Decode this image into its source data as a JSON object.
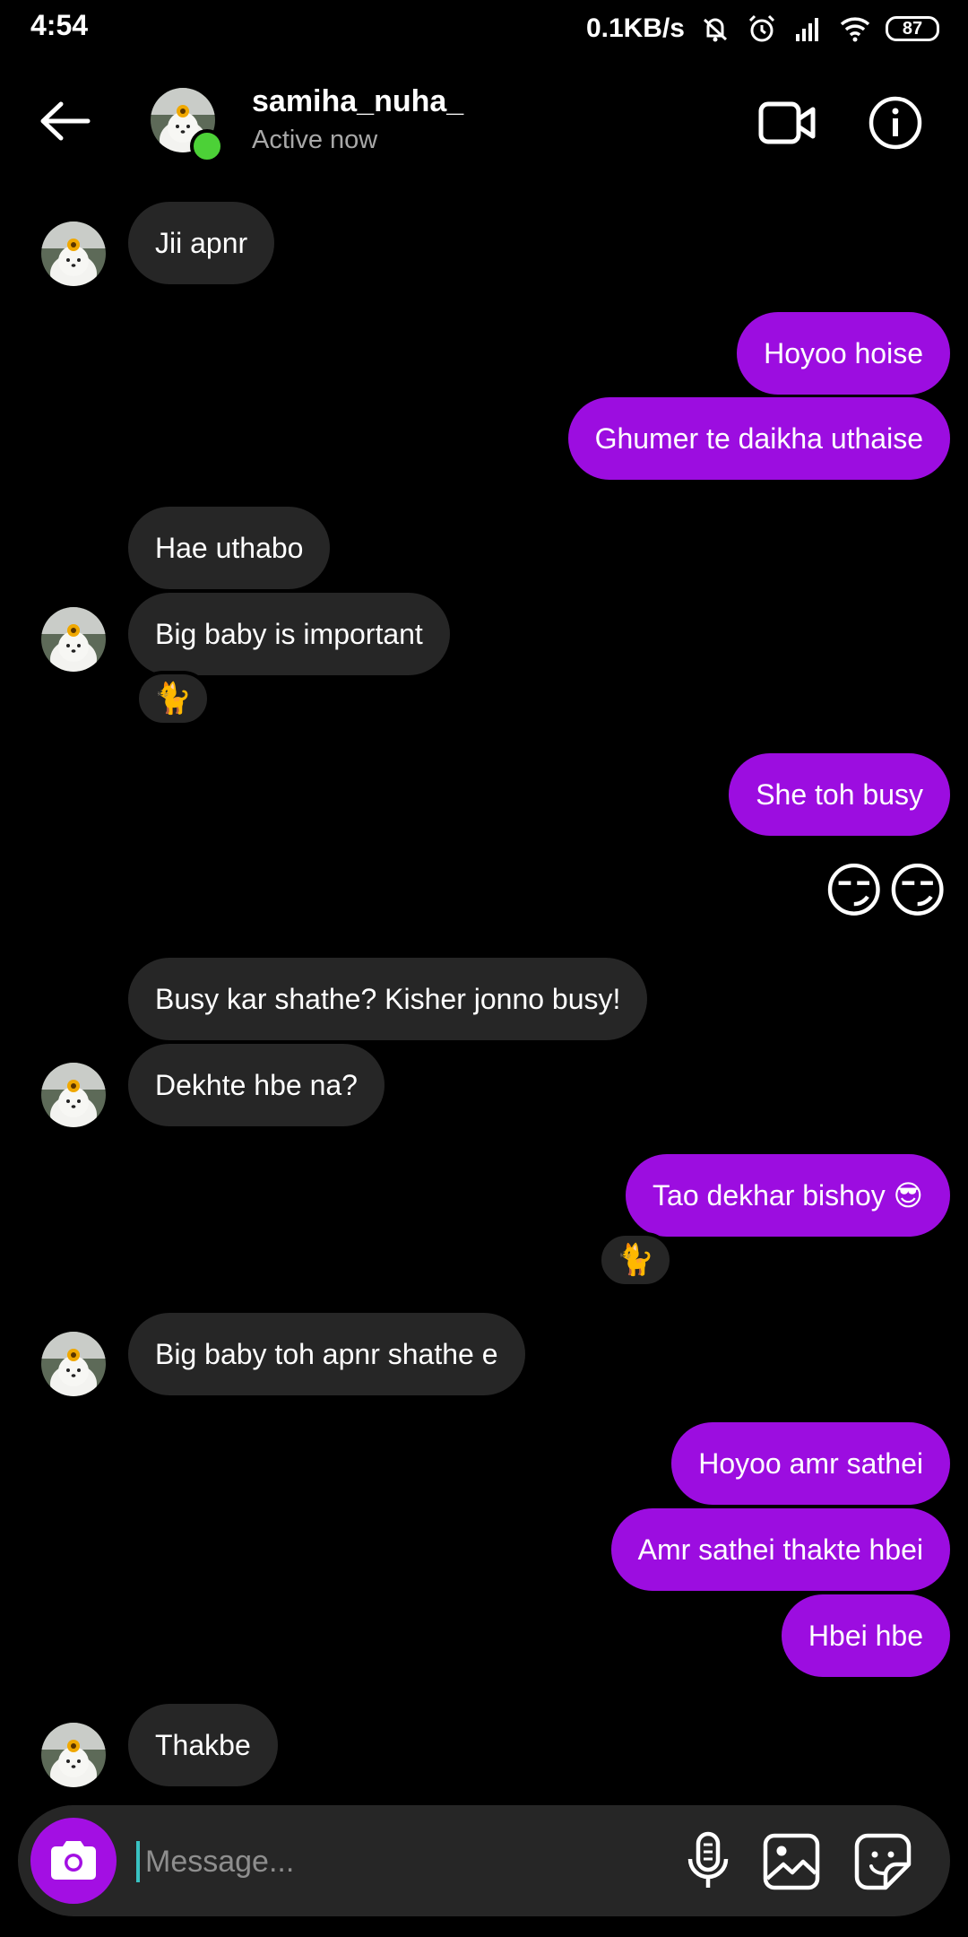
{
  "status_bar": {
    "time": "4:54",
    "speed": "0.1KB/s",
    "battery": "87"
  },
  "header": {
    "username": "samiha_nuha_",
    "status": "Active now"
  },
  "messages": [
    {
      "dir": "in",
      "text": "Jii apnr"
    },
    {
      "dir": "out",
      "text": "Hoyoo hoise"
    },
    {
      "dir": "out",
      "text": "Ghumer te daikha uthaise"
    },
    {
      "dir": "in",
      "text": "Hae uthabo"
    },
    {
      "dir": "in",
      "text": "Big baby is important",
      "reaction": "🐈"
    },
    {
      "dir": "out",
      "text": "She toh busy"
    },
    {
      "dir": "out",
      "text": "😏😏"
    },
    {
      "dir": "in",
      "text": "Busy kar shathe? Kisher jonno busy!"
    },
    {
      "dir": "in",
      "text": "Dekhte hbe na?"
    },
    {
      "dir": "out",
      "text": "Tao dekhar bishoy 😎",
      "reaction": "🐈"
    },
    {
      "dir": "in",
      "text": "Big baby toh apnr shathe e"
    },
    {
      "dir": "out",
      "text": "Hoyoo amr sathei"
    },
    {
      "dir": "out",
      "text": "Amr sathei thakte hbei"
    },
    {
      "dir": "out",
      "text": "Hbei hbe"
    },
    {
      "dir": "in",
      "text": "Thakbe"
    }
  ],
  "composer": {
    "placeholder": "Message..."
  },
  "colors": {
    "outgoing_bubble": "#9c0de0",
    "incoming_bubble": "#262626",
    "online_dot": "#4cd137"
  },
  "icons": [
    "back-arrow-icon",
    "video-call-icon",
    "info-icon",
    "camera-icon",
    "microphone-icon",
    "gallery-icon",
    "sticker-icon",
    "mute-bell-icon",
    "alarm-icon",
    "signal-icon",
    "wifi-icon"
  ]
}
